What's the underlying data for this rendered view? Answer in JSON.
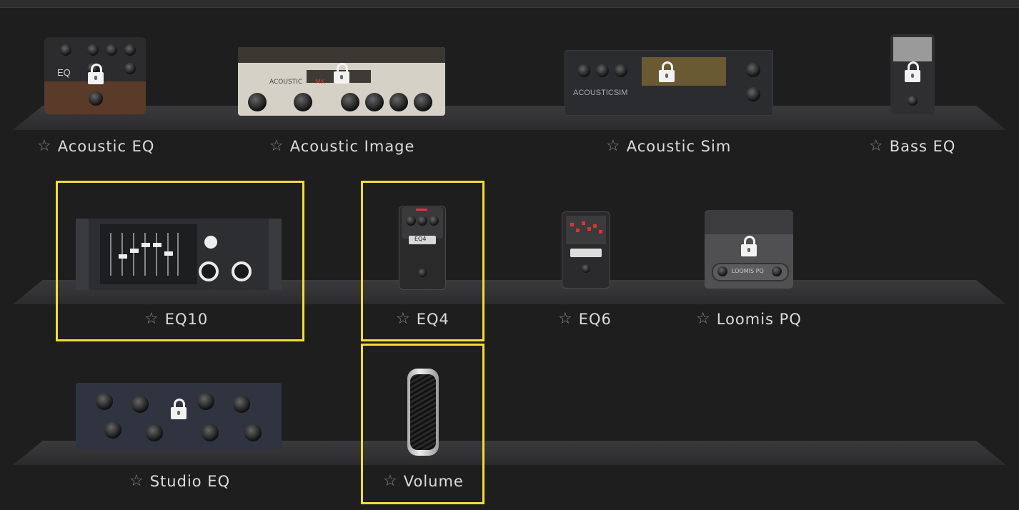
{
  "items": [
    {
      "key": "acoustic_eq",
      "label": "Acoustic EQ",
      "locked": true
    },
    {
      "key": "acoustic_image",
      "label": "Acoustic Image",
      "locked": true
    },
    {
      "key": "acoustic_sim",
      "label": "Acoustic Sim",
      "locked": true
    },
    {
      "key": "bass_eq",
      "label": "Bass EQ",
      "locked": true
    },
    {
      "key": "eq10",
      "label": "EQ10",
      "locked": false
    },
    {
      "key": "eq4",
      "label": "EQ4",
      "locked": false
    },
    {
      "key": "eq6",
      "label": "EQ6",
      "locked": false
    },
    {
      "key": "loomis_pq",
      "label": "Loomis PQ",
      "locked": true
    },
    {
      "key": "studio_eq",
      "label": "Studio EQ",
      "locked": true
    },
    {
      "key": "volume",
      "label": "Volume",
      "locked": false
    }
  ],
  "thumb_text": {
    "acoustic_eq": "EQ",
    "acoustic_image_brand": "ACOUSTIC",
    "acoustic_image_mk": "MK",
    "acoustic_sim": "ACOUSTICSIM",
    "eq4": "EQ4",
    "loomis": "LOOMIS PQ"
  },
  "colors": {
    "background": "#1e1e1f",
    "shelf": "#353537",
    "label": "#dcdcdc",
    "star": "#8a8a8a",
    "highlight": "#f3dc3a"
  }
}
